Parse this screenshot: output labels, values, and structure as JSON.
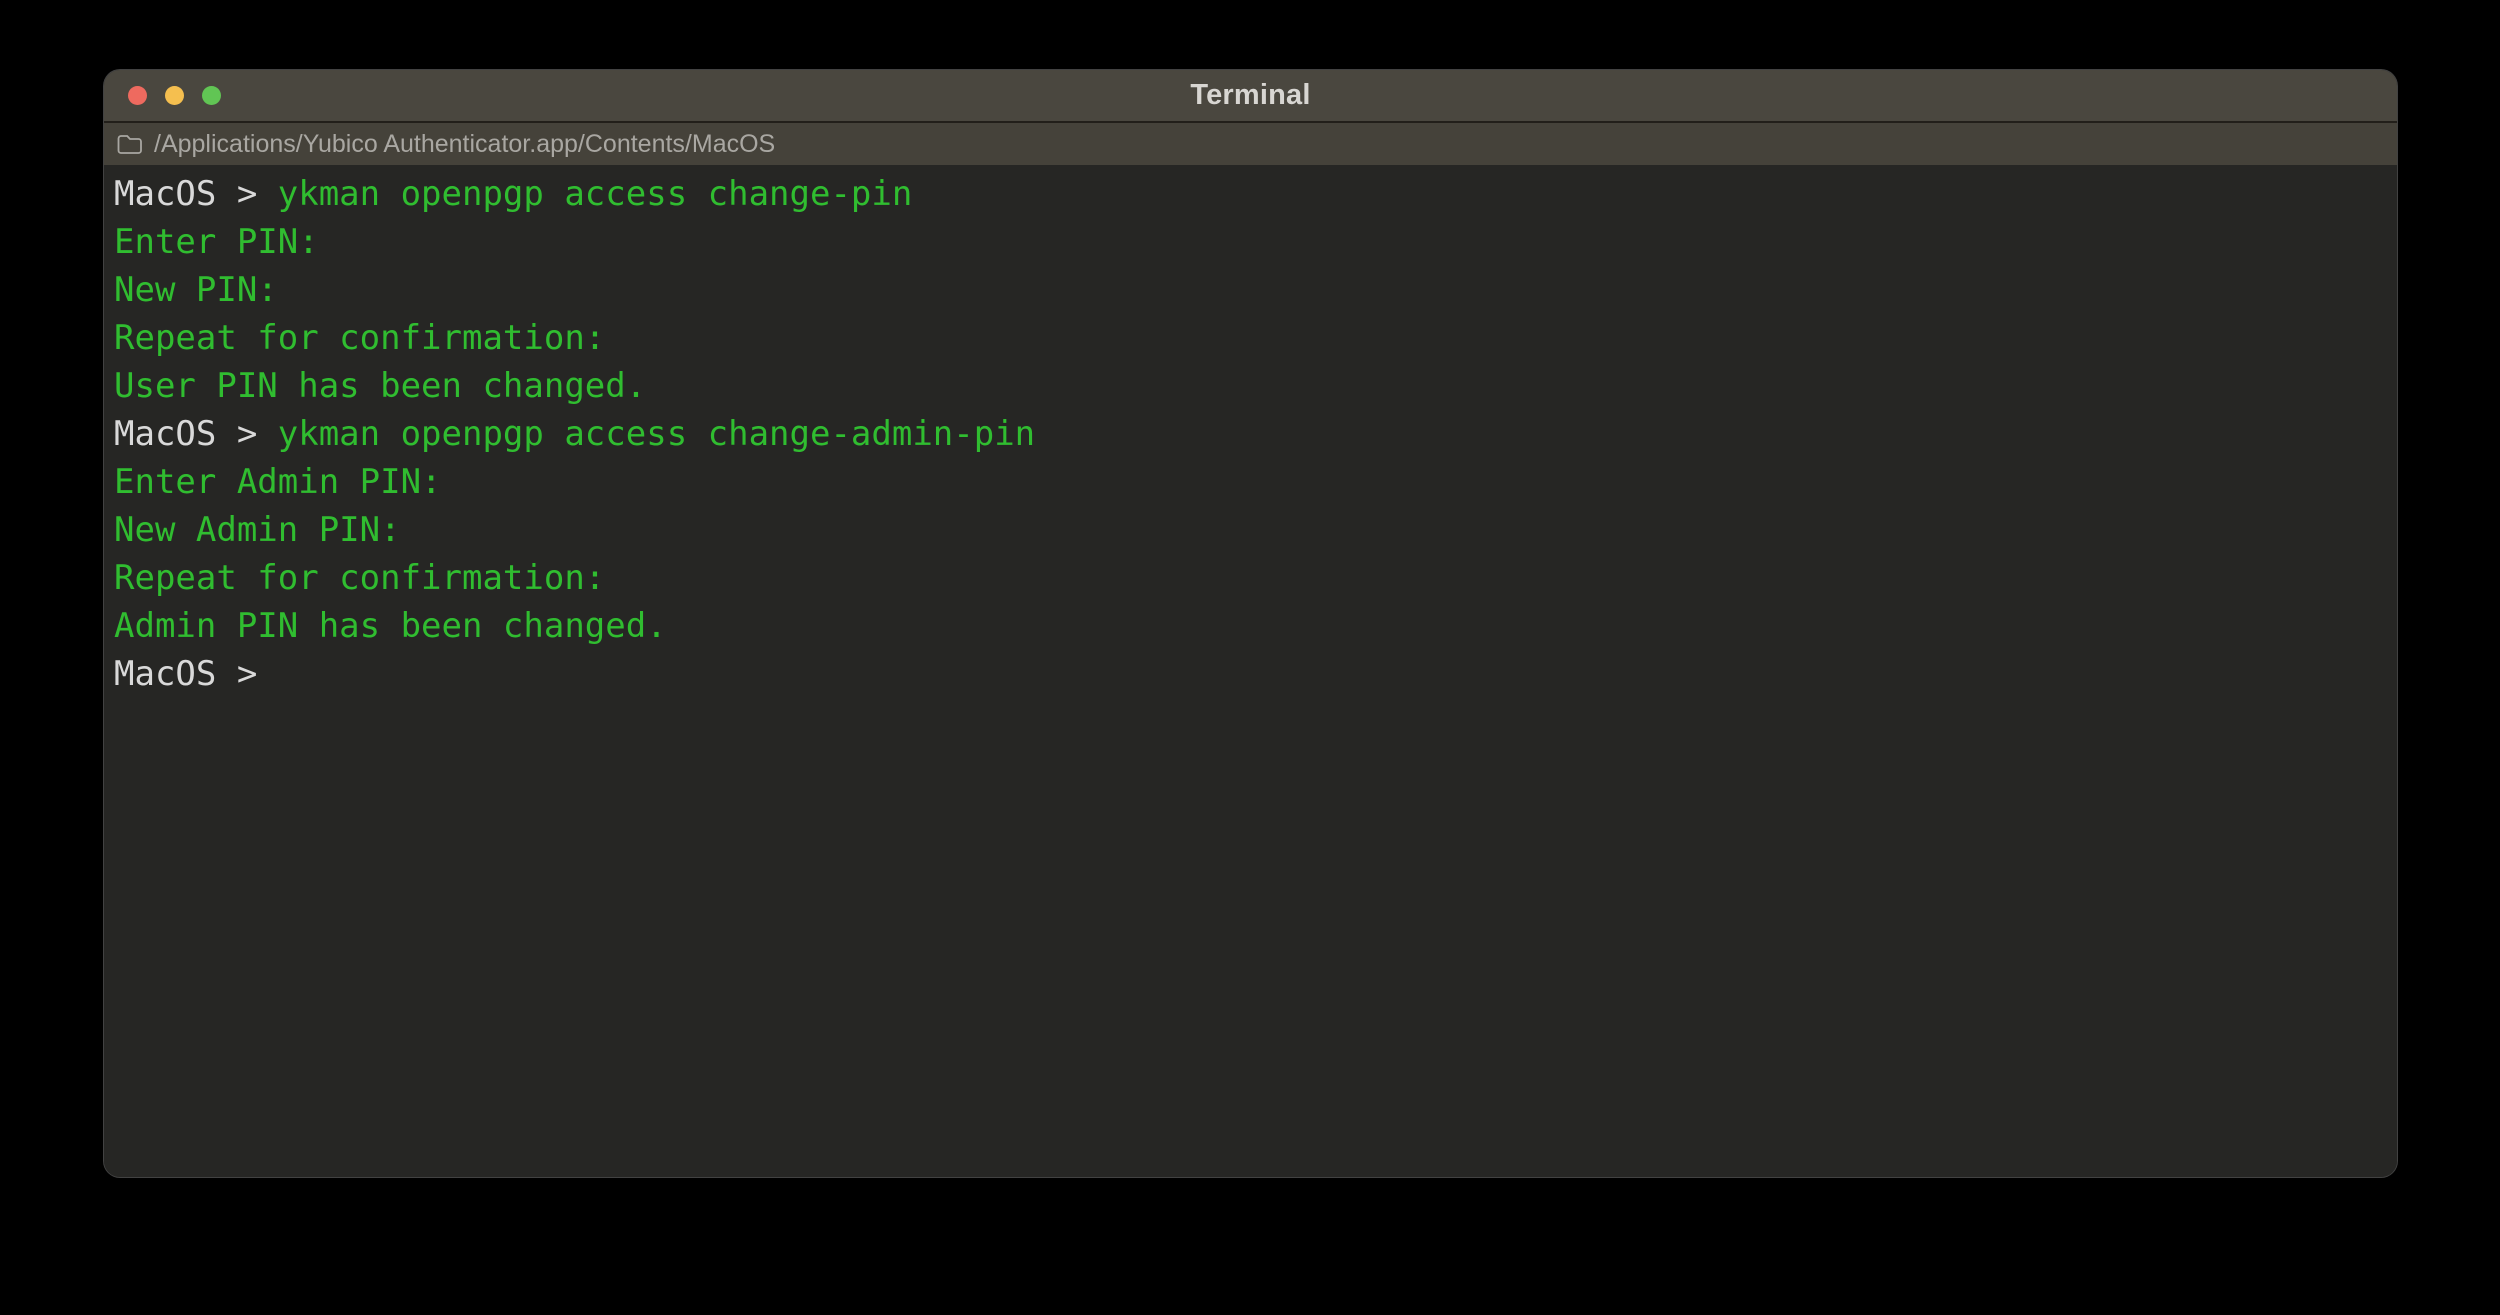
{
  "window": {
    "title": "Terminal",
    "path_bar": {
      "path": "/Applications/Yubico Authenticator.app/Contents/MacOS"
    }
  },
  "colors": {
    "close": "#ee6a5f",
    "minimize": "#f5bf4f",
    "zoom_btn": "#61c554",
    "titlebar_bg": "#4a473f",
    "pathbar_bg": "#45423a",
    "terminal_bg": "#262624",
    "prompt_text": "#d9d9d9",
    "terminal_green": "#30bd30",
    "title_text": "#d8d6d2",
    "path_text": "#a9a7a2"
  },
  "terminal": {
    "lines": [
      {
        "segments": [
          {
            "text": "MacOS > ",
            "type": "prompt"
          },
          {
            "text": "ykman openpgp access change-pin",
            "type": "command"
          }
        ]
      },
      {
        "segments": [
          {
            "text": "Enter PIN:",
            "type": "output"
          }
        ]
      },
      {
        "segments": [
          {
            "text": "New PIN:",
            "type": "output"
          }
        ]
      },
      {
        "segments": [
          {
            "text": "Repeat for confirmation:",
            "type": "output"
          }
        ]
      },
      {
        "segments": [
          {
            "text": "User PIN has been changed.",
            "type": "output"
          }
        ]
      },
      {
        "segments": [
          {
            "text": "MacOS > ",
            "type": "prompt"
          },
          {
            "text": "ykman openpgp access change-admin-pin",
            "type": "command"
          }
        ]
      },
      {
        "segments": [
          {
            "text": "Enter Admin PIN:",
            "type": "output"
          }
        ]
      },
      {
        "segments": [
          {
            "text": "New Admin PIN:",
            "type": "output"
          }
        ]
      },
      {
        "segments": [
          {
            "text": "Repeat for confirmation:",
            "type": "output"
          }
        ]
      },
      {
        "segments": [
          {
            "text": "Admin PIN has been changed.",
            "type": "output"
          }
        ]
      },
      {
        "segments": [
          {
            "text": "MacOS > ",
            "type": "prompt"
          }
        ]
      }
    ]
  }
}
